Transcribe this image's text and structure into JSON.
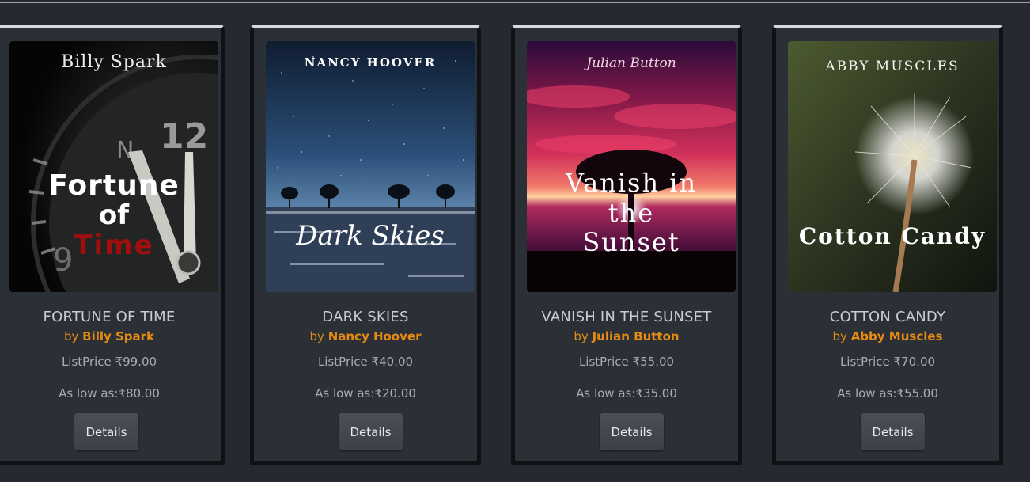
{
  "books": [
    {
      "cover_author": "Billy Spark",
      "cover_title": [
        "Fortune",
        "of",
        "Time"
      ],
      "title": "FORTUNE OF TIME",
      "by_prefix": "by",
      "author": "Billy Spark",
      "list_label": "ListPrice",
      "list_price": "₹99.00",
      "low_price_text": "As low as:₹80.00",
      "details_label": "Details"
    },
    {
      "cover_author": "NANCY HOOVER",
      "cover_title": [
        "Dark Skies"
      ],
      "title": "DARK SKIES",
      "by_prefix": "by",
      "author": "Nancy Hoover",
      "list_label": "ListPrice",
      "list_price": "₹40.00",
      "low_price_text": "As low as:₹20.00",
      "details_label": "Details"
    },
    {
      "cover_author": "Julian Button",
      "cover_title": [
        "Vanish in",
        "the",
        "Sunset"
      ],
      "title": "VANISH IN THE SUNSET",
      "by_prefix": "by",
      "author": "Julian Button",
      "list_label": "ListPrice",
      "list_price": "₹55.00",
      "low_price_text": "As low as:₹35.00",
      "details_label": "Details"
    },
    {
      "cover_author": "ABBY MUSCLES",
      "cover_title": [
        "Cotton Candy"
      ],
      "title": "COTTON CANDY",
      "by_prefix": "by",
      "author": "Abby Muscles",
      "list_label": "ListPrice",
      "list_price": "₹70.00",
      "low_price_text": "As low as:₹55.00",
      "details_label": "Details"
    }
  ],
  "colors": {
    "author_accent": "#e58a12",
    "card_background": "#2b3037",
    "page_background": "#262a30"
  }
}
